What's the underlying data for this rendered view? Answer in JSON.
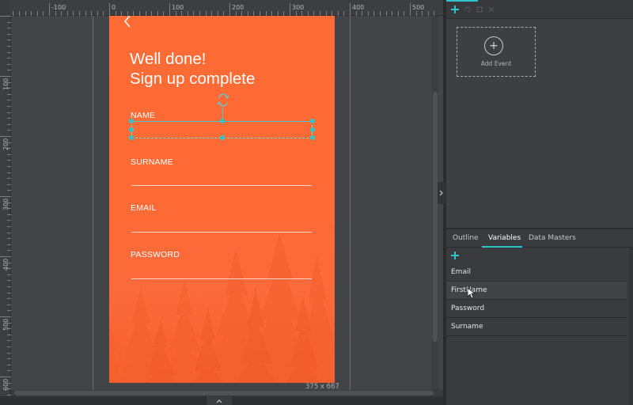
{
  "ruler": {
    "h_labels": [
      "-100",
      "0",
      "100",
      "200",
      "300",
      "400",
      "500"
    ],
    "v_labels": [
      "100",
      "200",
      "300",
      "400",
      "500",
      "600"
    ]
  },
  "artboard": {
    "headline_line1": "Well done!",
    "headline_line2": "Sign up complete",
    "fields": [
      "NAME",
      "SURNAME",
      "EMAIL",
      "PASSWORD"
    ],
    "size": "375 x 667"
  },
  "events": {
    "add_event_label": "Add Event"
  },
  "tabs": [
    "Outline",
    "Variables",
    "Data Masters"
  ],
  "active_tab": "Variables",
  "variables": [
    "Email",
    "FirstName",
    "Password",
    "Surname"
  ],
  "colors": {
    "accent": "#2ec4cf",
    "artboard_orange": "#ff6b34",
    "panel_bg": "#3b3c3f"
  },
  "icons": {
    "toolbar": [
      "plus-icon",
      "undo-icon",
      "copy-icon",
      "delete-icon"
    ],
    "artboard": [
      "chevron-left-icon",
      "rotate-icon"
    ],
    "variables": [
      "plus-icon"
    ],
    "canvas": [
      "chevron-right-icon",
      "chevron-up-icon"
    ]
  }
}
